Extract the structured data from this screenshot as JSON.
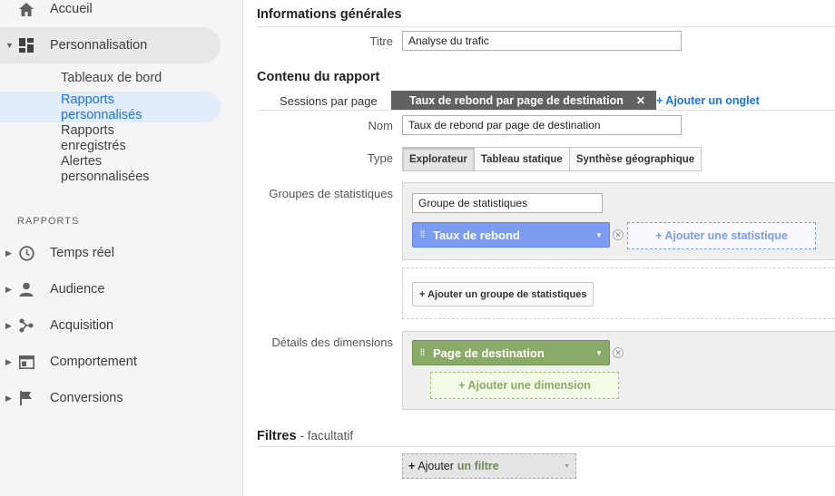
{
  "sidebar": {
    "home": "Accueil",
    "customization": "Personnalisation",
    "sub_items": [
      {
        "label": "Tableaux de bord"
      },
      {
        "label": "Rapports personnalisés"
      },
      {
        "label": "Rapports enregistrés"
      },
      {
        "label": "Alertes personnalisées"
      }
    ],
    "section_label": "RAPPORTS",
    "reports": [
      {
        "label": "Temps réel",
        "icon": "clock-icon"
      },
      {
        "label": "Audience",
        "icon": "person-icon"
      },
      {
        "label": "Acquisition",
        "icon": "acquisition-icon"
      },
      {
        "label": "Comportement",
        "icon": "behavior-icon"
      },
      {
        "label": "Conversions",
        "icon": "flag-icon"
      }
    ]
  },
  "general": {
    "heading": "Informations générales",
    "title_label": "Titre",
    "title_value": "Analyse du trafic"
  },
  "content": {
    "heading": "Contenu du rapport",
    "tabs": [
      {
        "label": "Sessions par page"
      },
      {
        "label": "Taux de rebond par page de destination"
      }
    ],
    "add_tab": "+ Ajouter un onglet",
    "name_label": "Nom",
    "name_value": "Taux de rebond par page de destination",
    "type_label": "Type",
    "types": [
      "Explorateur",
      "Tableau statique",
      "Synthèse géographique"
    ],
    "metric_groups_label": "Groupes de statistiques",
    "metric_group_name": "Groupe de statistiques",
    "metric": "Taux de rebond",
    "add_metric": "+ Ajouter une statistique",
    "add_metric_group": "+ Ajouter un groupe de statistiques",
    "dimensions_label": "Détails des dimensions",
    "dimension": "Page de destination",
    "add_dimension": "+ Ajouter une dimension"
  },
  "filters": {
    "heading": "Filtres",
    "optional": "- facultatif",
    "add_prefix": "+",
    "add_word": "Ajouter",
    "add_suffix": "un filtre"
  },
  "colors": {
    "metric": "#7b9cf0",
    "dimension": "#8aaa68",
    "link": "#1a73e8"
  }
}
